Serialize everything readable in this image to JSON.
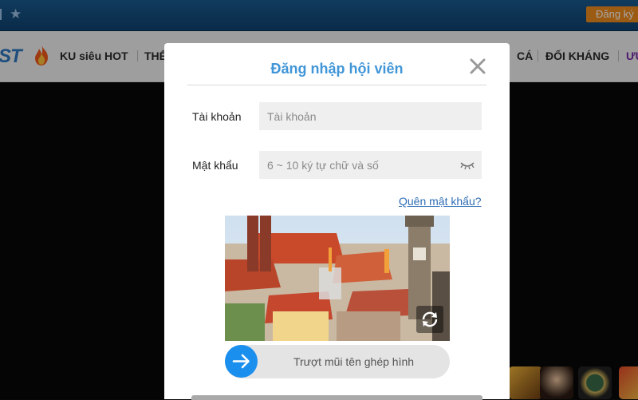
{
  "topbar": {
    "register_label": "Đăng ký"
  },
  "nav": {
    "logo_text": "ST",
    "items": [
      "KU siêu HOT",
      "THỂ",
      "CÁ",
      "ĐỐI KHÁNG",
      "ƯU"
    ]
  },
  "modal": {
    "title": "Đăng nhập hội viên",
    "account_label": "Tài khoản",
    "account_placeholder": "Tài khoản",
    "account_value": "",
    "password_label": "Mật khẩu",
    "password_placeholder": "6 ~ 10 ký tự chữ và số",
    "password_value": "",
    "forgot_label": "Quên mật khẩu?",
    "slider_label": "Trượt mũi tên ghép hình"
  },
  "icons": {
    "close": "close-icon",
    "eye": "eye-closed-icon",
    "refresh": "refresh-icon",
    "arrow": "arrow-right-icon",
    "star": "star-icon",
    "flame": "flame-icon"
  },
  "colors": {
    "accent": "#4196d8",
    "topbar": "#1b5b8f",
    "register": "#f08c1e",
    "slider_knob": "#1a8fee",
    "link": "#2f6db5"
  }
}
